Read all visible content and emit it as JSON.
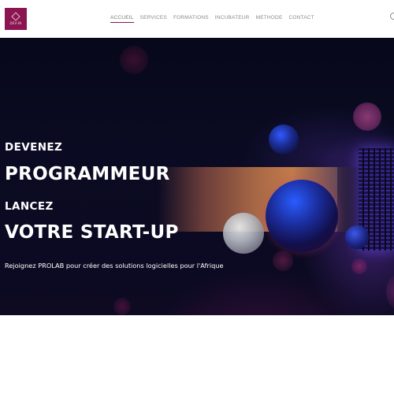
{
  "header": {
    "logo_text": "DEV-IN",
    "nav": [
      {
        "label": "ACCUEIL",
        "active": true
      },
      {
        "label": "SERVICES",
        "active": false
      },
      {
        "label": "FORMATIONS",
        "active": false
      },
      {
        "label": "INCUBATEUR",
        "active": false
      },
      {
        "label": "METHODE",
        "active": false
      },
      {
        "label": "CONTACT",
        "active": false
      }
    ],
    "accent_color": "#8a1550"
  },
  "hero": {
    "line1": "DEVENEZ",
    "line2": "PROGRAMMEUR",
    "line3": "LANCEZ",
    "line4": "VOTRE START-UP",
    "subtitle": "Rejoignez PROLAB pour créer des solutions logicielles pour l'Afrique"
  },
  "icons": {
    "search": "search-icon"
  }
}
